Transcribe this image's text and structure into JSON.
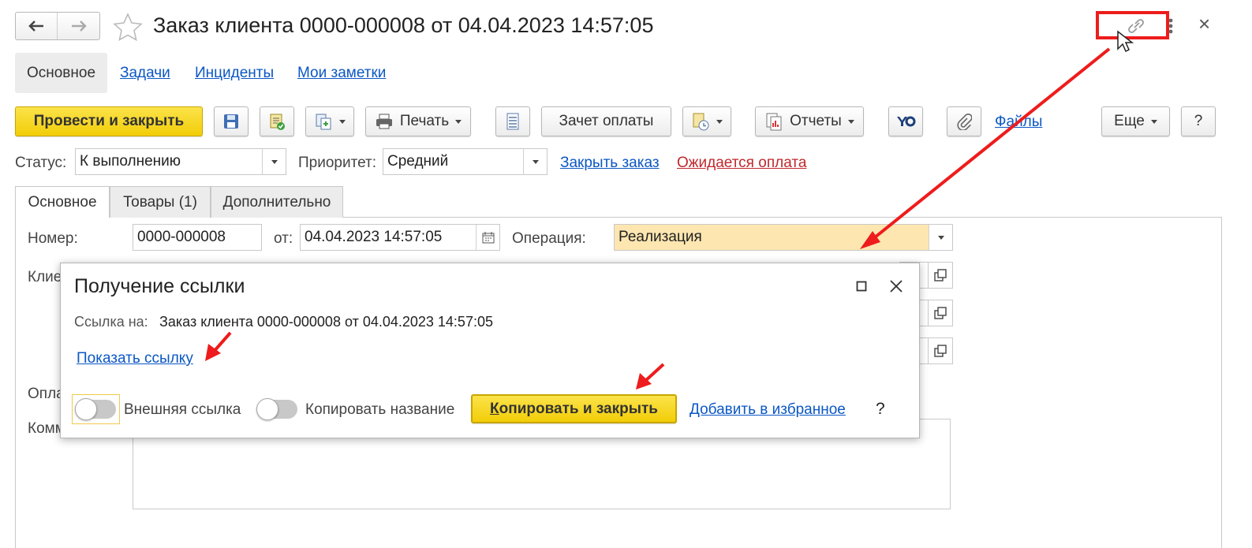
{
  "header": {
    "title": "Заказ клиента 0000-000008 от 04.04.2023 14:57:05",
    "back_icon": "arrow-left-icon",
    "forward_icon": "arrow-right-icon",
    "star_icon": "star-icon",
    "link_icon": "link-icon",
    "more_icon": "vertical-dots-icon",
    "close_label": "×"
  },
  "nav_tabs": [
    {
      "label": "Основное",
      "active": true
    },
    {
      "label": "Задачи"
    },
    {
      "label": "Инциденты"
    },
    {
      "label": "Мои заметки"
    }
  ],
  "toolbar": {
    "post_close": "Провести и закрыть",
    "print": "Печать",
    "offset_payment": "Зачет оплаты",
    "reports": "Отчеты",
    "files": "Файлы",
    "more": "Еще",
    "help": "?"
  },
  "status_row": {
    "status_label": "Статус:",
    "status_value": "К выполнению",
    "priority_label": "Приоритет:",
    "priority_value": "Средний",
    "close_order_link": "Закрыть заказ",
    "awaiting_payment_link": "Ожидается оплата"
  },
  "form_tabs": [
    {
      "label": "Основное",
      "active": true
    },
    {
      "label": "Товары (1)"
    },
    {
      "label": "Дополнительно"
    }
  ],
  "form": {
    "number_label": "Номер:",
    "number_value": "0000-000008",
    "date_label": "от:",
    "date_value": "04.04.2023 14:57:05",
    "operation_label": "Операция:",
    "operation_value": "Реализация",
    "client_label_partial": "Клие",
    "payment_label_partial": "Опла",
    "comment_label_partial": "Комм"
  },
  "dialog": {
    "title": "Получение ссылки",
    "link_to_label": "Ссылка на:",
    "link_to_value": "Заказ клиента 0000-000008 от 04.04.2023 14:57:05",
    "show_link": "Показать ссылку",
    "external_link": "Внешняя ссылка",
    "copy_name": "Копировать название",
    "copy_close_underlined": "К",
    "copy_close_rest": "опировать и закрыть",
    "add_favorites": "Добавить в избранное",
    "help": "?"
  },
  "colors": {
    "accent_yellow": "#f5d10b",
    "link_blue": "#0b57c4",
    "link_red": "#c0282d",
    "annotation_red": "#ee1c1c",
    "operation_bg": "#fde6b0"
  }
}
